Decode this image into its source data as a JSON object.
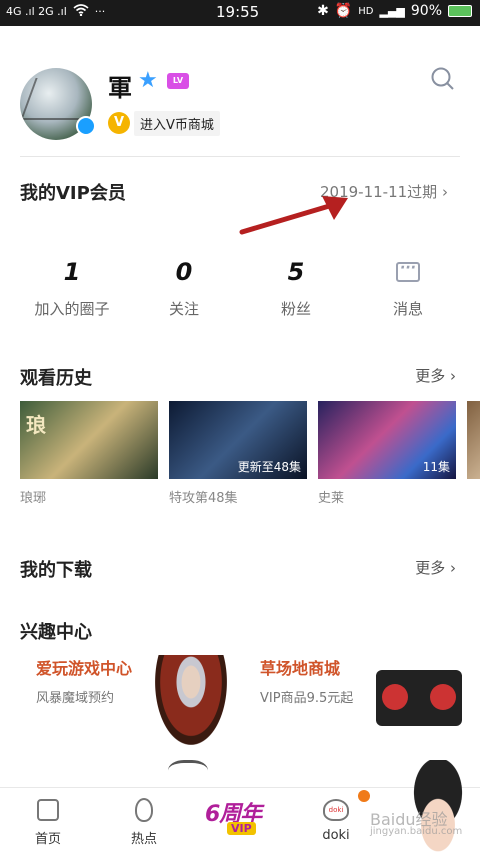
{
  "status_bar": {
    "signal": "4G .ıl 2G .ıl",
    "more": "···",
    "time": "19:55",
    "icons": [
      "bluetooth-icon",
      "alarm-icon",
      "hd-icon",
      "signal-icon"
    ],
    "battery": "90%"
  },
  "profile": {
    "username": "軍",
    "vcoin_label": "进入V币商城",
    "vcoin_icon": "V",
    "vip_badge": "LV"
  },
  "vip": {
    "title": "我的VIP会员",
    "expire": "2019-11-11过期 ›"
  },
  "stats": [
    {
      "num": "1",
      "label": "加入的圈子"
    },
    {
      "num": "0",
      "label": "关注"
    },
    {
      "num": "5",
      "label": "粉丝"
    },
    {
      "num": "",
      "label": "消息"
    }
  ],
  "history": {
    "title": "观看历史",
    "more": "更多 ›",
    "items": [
      {
        "overlay": "",
        "caption": "琅琊"
      },
      {
        "overlay": "更新至48集",
        "caption": "特攻第48集"
      },
      {
        "overlay": "11集",
        "caption": "史莱"
      },
      {
        "overlay": "",
        "caption": ""
      }
    ]
  },
  "downloads": {
    "title": "我的下载",
    "more": "更多 ›"
  },
  "interest": {
    "title": "兴趣中心",
    "items": [
      {
        "title": "爱玩游戏中心",
        "sub": "风暴魔域预约"
      },
      {
        "title": "草场地商城",
        "sub": "VIP商品9.5元起"
      }
    ]
  },
  "tabbar": {
    "home": "首页",
    "hot": "热点",
    "anniv_big": "6周年",
    "anniv_vip": "VIP",
    "doki": "doki"
  },
  "watermark": "Baidu经验",
  "watermark_url": "jingyan.baidu.com",
  "colors": {
    "accent_orange": "#d0542a",
    "vip_purple": "#b01f9a",
    "annotation_red": "#b52020"
  }
}
